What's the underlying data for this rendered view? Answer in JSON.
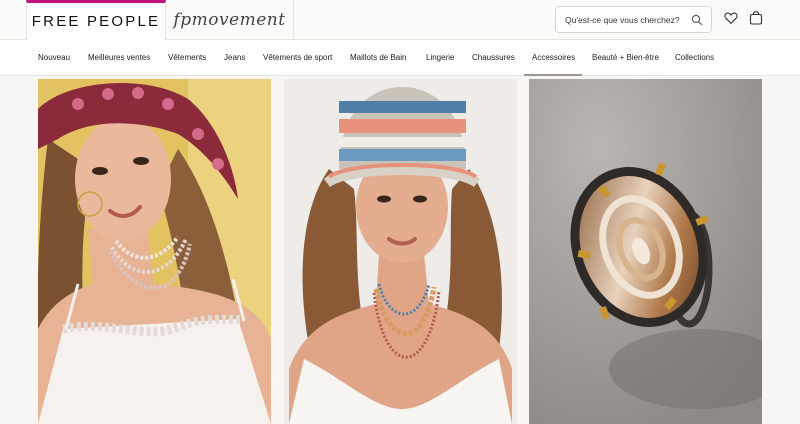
{
  "header": {
    "brand": "FREE PEOPLE",
    "movement": "fpmovement",
    "search_placeholder": "Qu'est-ce que vous cherchez?",
    "accent_color": "#c0117d"
  },
  "nav": {
    "items": [
      {
        "label": "Nouveau"
      },
      {
        "label": "Meilleures ventes"
      },
      {
        "label": "Vêtements"
      },
      {
        "label": "Jeans"
      },
      {
        "label": "Vêtements de sport"
      },
      {
        "label": "Maillots de Bain"
      },
      {
        "label": "Lingerie"
      },
      {
        "label": "Chaussures"
      },
      {
        "label": "Accessoires"
      },
      {
        "label": "Beauté + Bien-être"
      },
      {
        "label": "Collections"
      }
    ],
    "active": "Accessoires"
  },
  "tiles": [
    {
      "subject": "model-with-pink-headscarf-and-necklaces"
    },
    {
      "subject": "model-with-crochet-bucket-hat-and-necklaces"
    },
    {
      "subject": "agate-stone-ring"
    }
  ]
}
